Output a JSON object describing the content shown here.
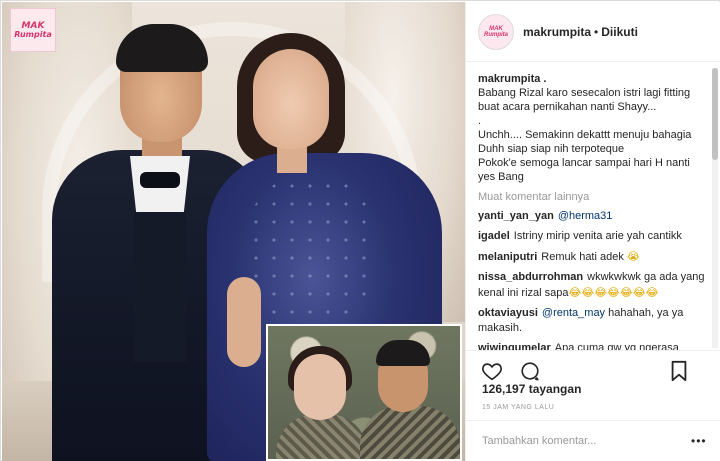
{
  "watermark": {
    "line1": "MAK",
    "line2": "Rumpita"
  },
  "header": {
    "avatar_text": "MAK Rumpita",
    "username": "makrumpita",
    "separator": "•",
    "follow_label": "Diikuti"
  },
  "caption": {
    "username": "makrumpita",
    "trailing": ".",
    "lines": [
      "Babang Rizal karo sesecalon istri lagi fitting",
      "buat acara pernikahan nanti Shayy...",
      ".",
      "Unchh.... Semakinn dekattt menuju bahagia",
      "Duhh siap siap nih terpoteque",
      "Pokok'e semoga lancar sampai hari H nanti",
      "yes Bang"
    ]
  },
  "load_more": "Muat komentar lainnya",
  "comments": [
    {
      "user": "yanti_yan_yan",
      "mention": "@herma31",
      "text": "",
      "emoji": ""
    },
    {
      "user": "igadel",
      "mention": "",
      "text": "Istriny mirip venita arie yah cantikk",
      "emoji": ""
    },
    {
      "user": "melaniputri",
      "mention": "",
      "text": "Remuk hati adek",
      "emoji": "😭"
    },
    {
      "user": "nissa_abdurrohman",
      "mention": "",
      "text": "wkwkwkwk ga ada yang kenal ini rizal sapa",
      "emoji": "😂😂😂😂😂😂😂"
    },
    {
      "user": "oktaviayusi",
      "mention": "@renta_may",
      "text": "hahahah, ya ya makasih.",
      "emoji": ""
    },
    {
      "user": "wiwingumelar",
      "mention": "",
      "text": "Apa cuma gw yg ngerasa",
      "emoji": ""
    }
  ],
  "actions": {
    "like_icon": "heart-icon",
    "comment_icon": "comment-icon",
    "save_icon": "bookmark-icon"
  },
  "views": "126,197 tayangan",
  "timestamp": "15 JAM YANG LALU",
  "add_comment": {
    "placeholder": "Tambahkan komentar...",
    "more_icon": "ellipsis-icon",
    "more_label": "•••"
  }
}
